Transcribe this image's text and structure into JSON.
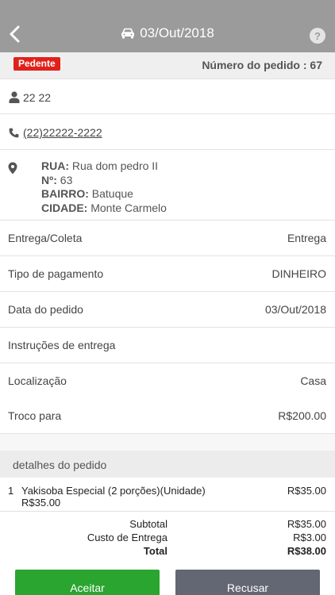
{
  "header": {
    "date": "03/Out/2018",
    "help": "?"
  },
  "status": {
    "badge": "Pedente",
    "order_number": "Número do pedido : 67"
  },
  "customer": {
    "name": "22 22",
    "phone": "(22)22222-2222",
    "address": {
      "street_label": "RUA:",
      "street": "Rua dom pedro II",
      "number_label": "Nº:",
      "number": "63",
      "district_label": "BAIRRO:",
      "district": "Batuque",
      "city_label": "CIDADE:",
      "city": "Monte Carmelo"
    }
  },
  "fields": [
    {
      "label": "Entrega/Coleta",
      "value": "Entrega"
    },
    {
      "label": "Tipo de pagamento",
      "value": "DINHEIRO"
    },
    {
      "label": "Data do pedido",
      "value": "03/Out/2018"
    },
    {
      "label": "Instruções de entrega",
      "value": ""
    },
    {
      "label": "Localização",
      "value": "Casa"
    },
    {
      "label": "Troco para",
      "value": "R$200.00"
    }
  ],
  "details": {
    "title": "detalhes do pedido",
    "items": [
      {
        "qty": "1",
        "name": "Yakisoba Especial (2 porções)(Unidade)",
        "unit_price": "R$35.00",
        "price": "R$35.00"
      }
    ],
    "subtotal_label": "Subtotal",
    "subtotal": "R$35.00",
    "delivery_label": "Custo de Entrega",
    "delivery": "R$3.00",
    "total_label": "Total",
    "total": "R$38.00"
  },
  "actions": {
    "accept": "Aceitar",
    "refuse": "Recusar"
  },
  "colors": {
    "header": "#9b9b9b",
    "badge": "#e0211a",
    "accept": "#2aa52f",
    "refuse": "#636773"
  }
}
